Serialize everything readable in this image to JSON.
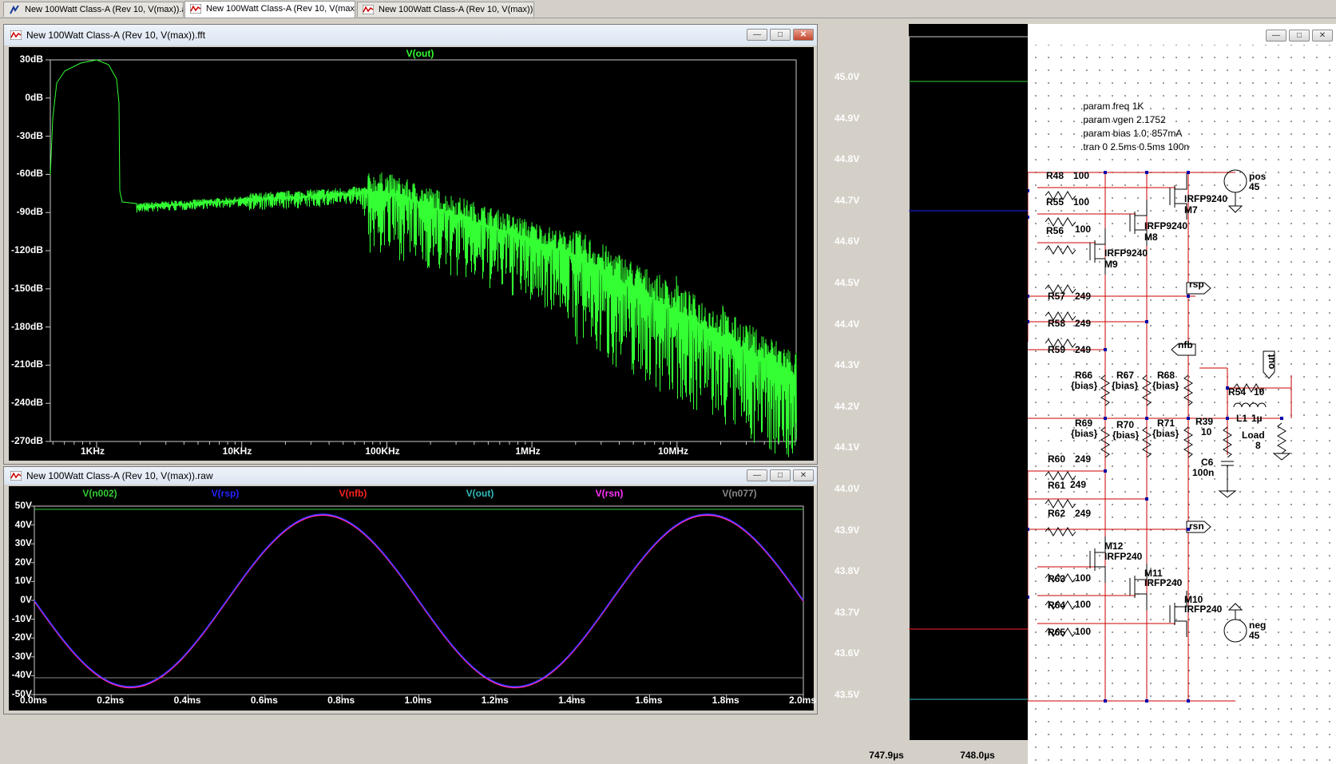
{
  "tabs": [
    {
      "label": "New 100Watt Class-A (Rev 10, V(max)).asc",
      "active": false
    },
    {
      "label": "New 100Watt Class-A (Rev 10, V(max)).fft",
      "active": true
    },
    {
      "label": "New 100Watt Class-A (Rev 10, V(max)).raw",
      "active": false
    }
  ],
  "fft_window": {
    "title": "New 100Watt Class-A (Rev 10, V(max)).fft",
    "trace_label": "V(out)",
    "trace_color": "#33ff33",
    "y_ticks": [
      "30dB",
      "0dB",
      "-30dB",
      "-60dB",
      "-90dB",
      "-120dB",
      "-150dB",
      "-180dB",
      "-210dB",
      "-240dB",
      "-270dB"
    ],
    "x_ticks": [
      "1KHz",
      "10KHz",
      "100KHz",
      "1MHz",
      "10MHz"
    ]
  },
  "raw_window": {
    "title": "New 100Watt Class-A (Rev 10, V(max)).raw",
    "traces": [
      {
        "label": "V(n002)",
        "color": "#33cc33"
      },
      {
        "label": "V(rsp)",
        "color": "#2222ff"
      },
      {
        "label": "V(nfb)",
        "color": "#ff2222"
      },
      {
        "label": "V(out)",
        "color": "#33bbbb"
      },
      {
        "label": "V(rsn)",
        "color": "#ff33ff"
      },
      {
        "label": "V(n077)",
        "color": "#888888"
      }
    ],
    "y_ticks": [
      "50V",
      "40V",
      "30V",
      "20V",
      "10V",
      "0V",
      "-10V",
      "-20V",
      "-30V",
      "-40V",
      "-50V"
    ],
    "x_ticks": [
      "0.0ms",
      "0.2ms",
      "0.4ms",
      "0.6ms",
      "0.8ms",
      "1.0ms",
      "1.2ms",
      "1.4ms",
      "1.6ms",
      "1.8ms",
      "2.0ms"
    ]
  },
  "zoom_plot": {
    "y_ticks": [
      "45.0V",
      "44.9V",
      "44.8V",
      "44.7V",
      "44.6V",
      "44.5V",
      "44.4V",
      "44.3V",
      "44.2V",
      "44.1V",
      "44.0V",
      "43.9V",
      "43.8V",
      "43.7V",
      "43.6V",
      "43.5V"
    ],
    "x_ticks": [
      "747.9µs",
      "748.0µs"
    ]
  },
  "schematic": {
    "directives": [
      ".param freq 1K",
      ".param vgen 2.1752",
      ".param bias 1.0; 857mA",
      ".tran 0 2.5ms 0.5ms 100n"
    ],
    "labels": {
      "r48": "R48",
      "r48v": "100",
      "r55": "R55",
      "r55v": "100",
      "r56": "R56",
      "r56v": "100",
      "m7p": "IRFP9240",
      "m7": "M7",
      "m8p": "IRFP9240",
      "m8": "M8",
      "m9p": "IRFP9240",
      "m9": "M9",
      "pos": "pos",
      "posv": "45",
      "rsp": "rsp",
      "r57": "R57",
      "r57v": "249",
      "r58": "R58",
      "r58v": "249",
      "r59": "R59",
      "r59v": "249",
      "nfb": "nfb",
      "out": "out",
      "r66": "R66",
      "r67": "R67",
      "r68": "R68",
      "bias": "{bias}",
      "r54": "R54",
      "r54v": "10",
      "l1": "L1",
      "l1v": "1µ",
      "r69": "R69",
      "r70": "R70",
      "r71": "R71",
      "r39": "R39",
      "r39v": "10",
      "load": "Load",
      "loadv": "8",
      "c6": "C6",
      "c6v": "100n",
      "r60": "R60",
      "r60v": "249",
      "r61": "R61",
      "r61v": "249",
      "r62": "R62",
      "r62v": "249",
      "rsn": "rsn",
      "m12": "M12",
      "m12p": "IRFP240",
      "m11": "M11",
      "m11p": "IRFP240",
      "m10": "M10",
      "m10p": "IRFP240",
      "r63": "R63",
      "r63v": "100",
      "r64": "R64",
      "r64v": "100",
      "r65": "R65",
      "r65v": "100",
      "neg": "neg",
      "negv": "45"
    }
  }
}
